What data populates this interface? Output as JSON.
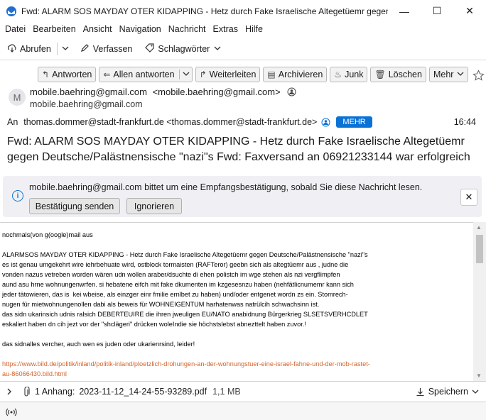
{
  "window": {
    "title": "Fwd: ALARM SOS MAYDAY OTER KIDAPPING - Hetz durch Fake Israelische Altegetüemr gegen D...",
    "minimize": "—",
    "maximize": "☐",
    "close": "✕"
  },
  "menu": {
    "datei": "Datei",
    "bearbeiten": "Bearbeiten",
    "ansicht": "Ansicht",
    "navigation": "Navigation",
    "nachricht": "Nachricht",
    "extras": "Extras",
    "hilfe": "Hilfe"
  },
  "toolbar": {
    "abrufen": "Abrufen",
    "verfassen": "Verfassen",
    "schlagwoerter": "Schlagwörter"
  },
  "header_buttons": {
    "antworten": "Antworten",
    "allen_antworten": "Allen antworten",
    "weiterleiten": "Weiterleiten",
    "archivieren": "Archivieren",
    "junk": "Junk",
    "loeschen": "Löschen",
    "mehr": "Mehr"
  },
  "message": {
    "avatar_letter": "M",
    "from_name": "mobile.baehring@gmail.com",
    "from_addr": "<mobile.baehring@gmail.com>",
    "from_sub": "mobile.baehring@gmail.com",
    "to_label": "An",
    "to": "thomas.dommer@stadt-frankfurt.de <thomas.dommer@stadt-frankfurt.de>",
    "mehr": "MEHR",
    "time": "16:44",
    "subject": "Fwd: ALARM SOS MAYDAY OTER KIDAPPING - Hetz durch Fake Israelische Altegetüemr gegen Deutsche/Palästnensische \"nazi\"s Fwd: Faxversand an 06921233144 war erfolgreich"
  },
  "notice": {
    "text": "mobile.baehring@gmail.com bittet um eine Empfangsbestätigung, sobald Sie diese Nachricht lesen.",
    "send_button": "Bestätigung senden",
    "ignore_button": "Ignorieren"
  },
  "body": {
    "line1": "nochmals(von g(oogle)mail aus",
    "para1_l1": "ALARMSOS MAYDAY OTER KIDAPPING - Hetz durch Fake Israelische Altegetüemr gegen Deutsche/Palästnensische \"nazi\"s",
    "para1_l2": "es ist genau umgekehrt wire iehrbehuate wird, ostblock tormaisten (RAFTeror) geebn sich als altegtüemr aus , judne die",
    "para1_l3": "vonden nazus vetreben worden wären udn wollen araber/dsuchte di ehen polistch im wge stehen als nzi vergflimpfen",
    "para1_l4": "aund asu hrne wohnungenwrfen. si hebatene eifch mit fake dkumenten im kzgesesnzu haben (nehfätlicnumemr kann sich",
    "para1_l5": "jeder tätowieren, das is  kei wbeise, als einzger einr fmilie ernlbet zu haben) und/oder entgenet wordn zs ein. Stomrech-",
    "para1_l6": "nugen für mietwohnungenollen dabi als beweis für WOHNEIGENTUM harhatenwas natrülcih schwachsinn ist.",
    "para1_l7": "das sidn ukarinsich udnis ralsich DEBERTEUIRE die ihren jweuligen EU/NATO anabidnung Bürgerkrieg SLSETSVERHCDLET",
    "para1_l8": "eskaliert haben dn cih jezt vor der \"shclägeri\" drücken woleIndie sie höchstslebst abnezttelt haben zuvor.!",
    "para2": "das sidnalles vercher, auch wen es juden oder ukarienrsind, leider!",
    "link_l1": "https://www.bild.de/politik/inland/politik-inland/ploetzlich-drohungen-an-der-wohnungstuer-eine-israel-fahne-und-der-mob-rastet-",
    "link_l2": "au-86066430.bild.html"
  },
  "attachment": {
    "count_label": "1 Anhang:",
    "filename": "2023-11-12_14-24-55-93289.pdf",
    "size": "1,1 MB",
    "save": "Speichern"
  },
  "colors": {
    "accent": "#0a72d6",
    "link": "#d4632a",
    "notice_bg": "#f0f0f4"
  }
}
